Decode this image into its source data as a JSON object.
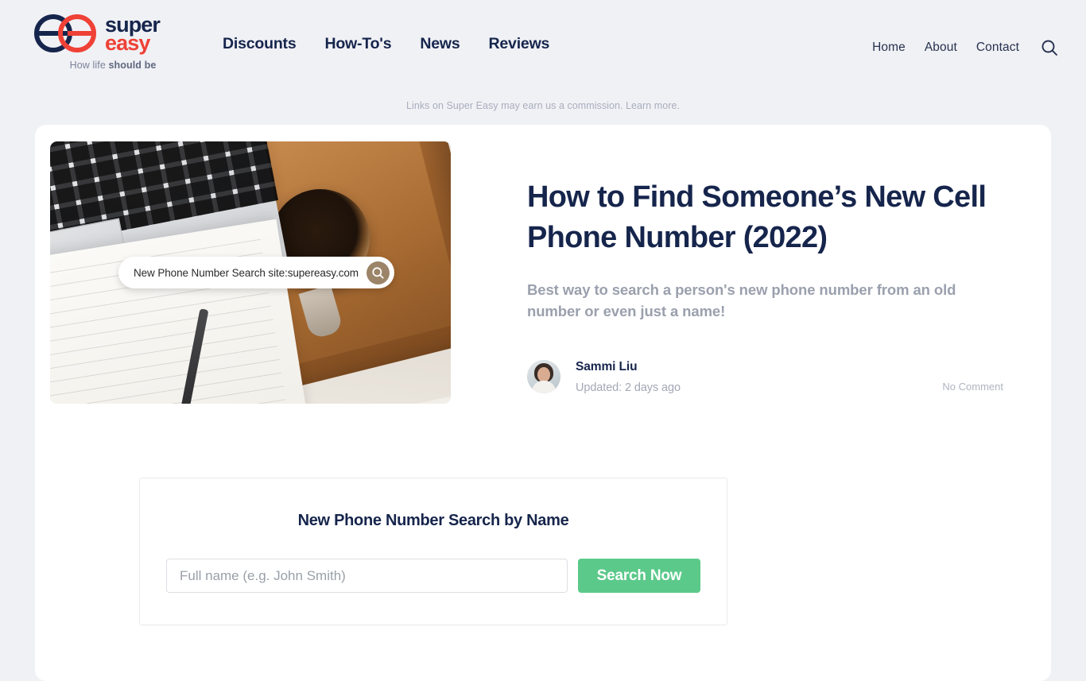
{
  "brand": {
    "name_line1": "super",
    "name_line2": "easy",
    "tagline_normal": "How life ",
    "tagline_bold": "should be",
    "navy": "#16254c",
    "red": "#ef4136"
  },
  "nav": {
    "main": [
      {
        "label": "Discounts"
      },
      {
        "label": "How-To's"
      },
      {
        "label": "News"
      },
      {
        "label": "Reviews"
      }
    ],
    "utility": [
      {
        "label": "Home"
      },
      {
        "label": "About"
      },
      {
        "label": "Contact"
      }
    ],
    "search_icon": "search-icon"
  },
  "disclosure": {
    "text": "Links on Super Easy may earn us a commission. Learn more."
  },
  "article": {
    "title": "How to Find Someone’s New Cell Phone Number (2022)",
    "subtitle": "Best way to search a person's new phone number from an old number or even just a name!",
    "hero": {
      "pill_text": "New Phone Number Search site:supereasy.com",
      "pill_icon": "search-icon"
    },
    "author": {
      "name": "Sammi Liu",
      "updated": "Updated: 2 days ago",
      "avatar_icon": "avatar"
    },
    "comments": "No Comment"
  },
  "widget": {
    "title": "New Phone Number Search by Name",
    "input_value": "",
    "input_placeholder": "Full name (e.g. John Smith)",
    "submit_label": "Search Now",
    "submit_color": "#5bc98a"
  }
}
